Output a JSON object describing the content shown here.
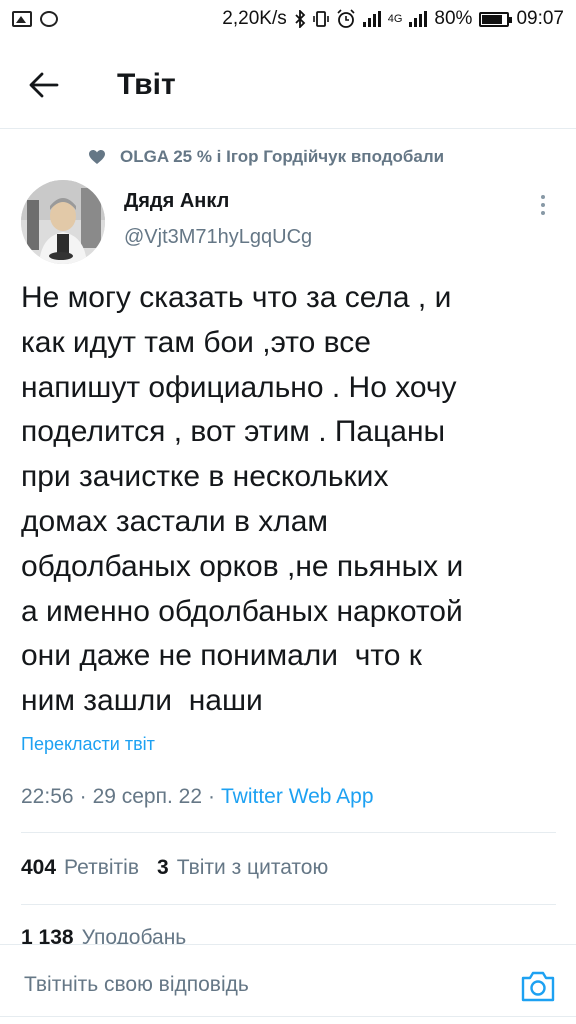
{
  "status_bar": {
    "speed": "2,20K/s",
    "network": "4G",
    "battery_text": "80%",
    "battery_level": 0.8,
    "time": "09:07"
  },
  "header": {
    "title": "Твіт"
  },
  "social_context": {
    "text": "OLGA 25 % і Ігор Гордійчук вподобали"
  },
  "author": {
    "name": "Дядя Анкл",
    "handle": "@Vjt3M71hyLgqUCg"
  },
  "tweet": {
    "lines": [
      "Не могу сказать что за села , и",
      "как идут там бои ,это все",
      "напишут официально . Но хочу",
      "поделится , вот этим . Пацаны",
      "при зачистке в нескольких",
      "домах застали в хлам",
      "обдолбаных орков ,не пьяных и",
      "а именно обдолбаных наркотой",
      "они даже не понимали  что к",
      "ним зашли  наши"
    ],
    "translate_label": "Перекласти твіт",
    "time": "22:56",
    "sep": "·",
    "date": "29 серп. 22",
    "source": "Twitter Web App"
  },
  "stats": {
    "retweets_count": "404",
    "retweets_label": "Ретвітів",
    "quotes_count": "3",
    "quotes_label": "Твіти з цитатою",
    "likes_count": "1 138",
    "likes_label": "Уподобань"
  },
  "reply": {
    "placeholder": "Твітніть свою відповідь"
  },
  "colors": {
    "accent": "#1da1f2",
    "muted": "#657786",
    "text": "#14171a",
    "divider": "#e6ecf0"
  },
  "icons": [
    "image-icon",
    "chat-icon",
    "bluetooth-icon",
    "vibrate-icon",
    "alarm-icon",
    "signal-icon",
    "battery-icon",
    "back-arrow-icon",
    "heart-icon",
    "more-vertical-icon",
    "camera-icon"
  ]
}
